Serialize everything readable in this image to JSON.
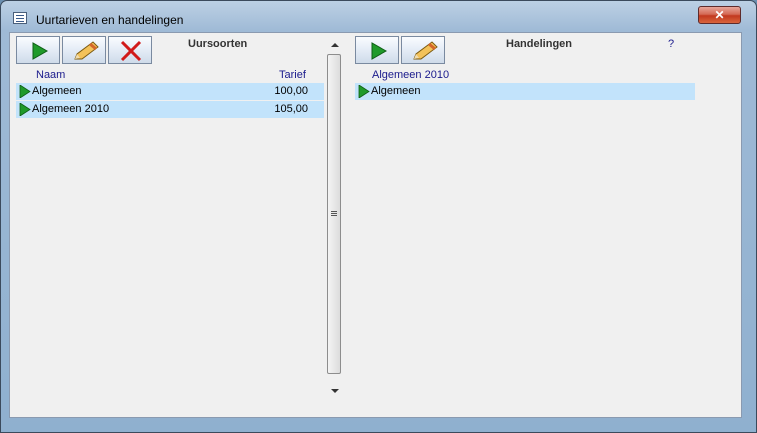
{
  "window": {
    "title": "Uurtarieven en handelingen",
    "close_glyph": "✕"
  },
  "left": {
    "title": "Uursoorten",
    "columns": {
      "name": "Naam",
      "value": "Tarief"
    },
    "rows": [
      {
        "name": "Algemeen",
        "value": "100,00"
      },
      {
        "name": "Algemeen 2010",
        "value": "105,00"
      }
    ],
    "toolbar": {
      "icons": [
        "play-icon",
        "pencil-icon",
        "delete-x-icon"
      ]
    }
  },
  "right": {
    "title": "Handelingen",
    "help": "?",
    "subheader": "Algemeen 2010",
    "rows": [
      {
        "name": "Algemeen"
      }
    ],
    "toolbar": {
      "icons": [
        "play-icon",
        "pencil-icon"
      ]
    }
  },
  "colors": {
    "row_highlight": "#c2e3fb",
    "header_text": "#1a1a8c",
    "play_green": "#1f9a2a",
    "delete_red": "#d11a1a"
  }
}
